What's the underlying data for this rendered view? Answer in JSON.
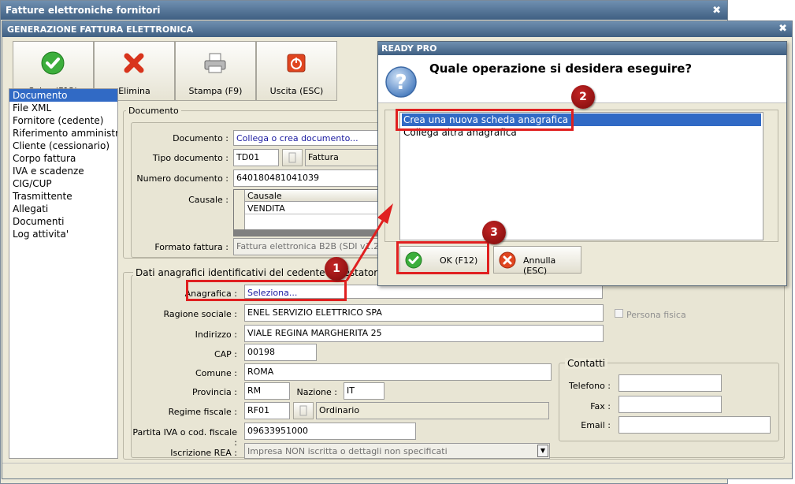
{
  "outer_window": {
    "title": "Fatture elettroniche fornitori",
    "close": "✖"
  },
  "inner_window": {
    "title": "GENERAZIONE FATTURA ELETTRONICA",
    "close": "✖"
  },
  "toolbar": {
    "save_label": "Salva (F12)",
    "delete_label": "Elimina",
    "print_label": "Stampa (F9)",
    "exit_label": "Uscita (ESC)"
  },
  "nav": {
    "items": [
      "Documento",
      "File XML",
      "Fornitore (cedente)",
      "Riferimento amministra",
      "Cliente (cessionario)",
      "Corpo fattura",
      "IVA e scadenze",
      "CIG/CUP",
      "Trasmittente",
      "Allegati",
      "Documenti",
      "Log attivita'"
    ]
  },
  "documento": {
    "group_title": "Documento",
    "documento_label": "Documento :",
    "documento_value": "Collega o crea documento...",
    "tipo_label": "Tipo documento :",
    "tipo_code": "TD01",
    "tipo_desc": "Fattura",
    "numero_label": "Numero documento :",
    "numero_value": "640180481041039",
    "causale_label": "Causale :",
    "causale_header": "Causale",
    "causale_value": "VENDITA",
    "formato_label": "Formato fattura :",
    "formato_value": "Fattura elettronica B2B (SDI v1.2)"
  },
  "cedente": {
    "group_title": "Dati anagrafici identificativi del cedente / prestatore",
    "anagrafica_label": "Anagrafica :",
    "anagrafica_value": "Seleziona...",
    "ragione_label": "Ragione sociale :",
    "ragione_value": "ENEL SERVIZIO ELETTRICO SPA",
    "persona_fisica_label": "Persona fisica",
    "indirizzo_label": "Indirizzo :",
    "indirizzo_value": "VIALE REGINA MARGHERITA 25",
    "cap_label": "CAP :",
    "cap_value": "00198",
    "comune_label": "Comune :",
    "comune_value": "ROMA",
    "provincia_label": "Provincia :",
    "provincia_value": "RM",
    "nazione_label": "Nazione :",
    "nazione_value": "IT",
    "regime_label": "Regime fiscale :",
    "regime_code": "RF01",
    "regime_desc": "Ordinario",
    "piva_label": "Partita IVA o cod. fiscale :",
    "piva_value": "09633951000",
    "rea_label": "Iscrizione REA :",
    "rea_value": "Impresa NON iscritta o dettagli non specificati"
  },
  "contatti": {
    "title": "Contatti",
    "telefono_label": "Telefono :",
    "fax_label": "Fax :",
    "email_label": "Email :"
  },
  "dialog": {
    "title": "READY PRO",
    "question": "Quale operazione si desidera eseguire?",
    "options": [
      "Crea una nuova scheda anagrafica",
      "Collega altra anagrafica"
    ],
    "ok_label": "OK (F12)",
    "cancel_label": "Annulla (ESC)"
  },
  "annotations": {
    "badge1": "1",
    "badge2": "2",
    "badge3": "3"
  },
  "colors": {
    "highlight": "#e02020",
    "selection": "#316ac5",
    "titlebar": "#4f6f92"
  }
}
